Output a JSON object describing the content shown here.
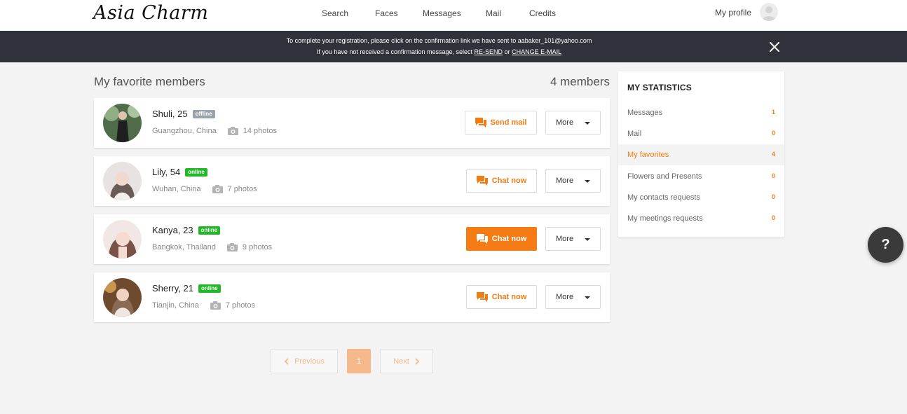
{
  "header": {
    "logo": "Asia Charm",
    "nav": [
      {
        "label": "Search"
      },
      {
        "label": "Faces"
      },
      {
        "label": "Messages"
      },
      {
        "label": "Mail"
      },
      {
        "label": "Credits"
      }
    ],
    "profile_label": "My profile"
  },
  "notice": {
    "line1": "To complete your registration, please click on the confirmation link we have sent to aabaker_101@yahoo.com",
    "line2_prefix": "If you have not received a confirmation message, select",
    "resend": "RE-SEND",
    "or": "or",
    "change_email": "CHANGE E-MAIL"
  },
  "main": {
    "title": "My favorite members",
    "count": "4 members",
    "members": [
      {
        "name": "Shuli, 25",
        "status": "offline",
        "location": "Guangzhou, China",
        "photos": "14 photos",
        "action": "Send mail",
        "more": "More"
      },
      {
        "name": "Lily, 54",
        "status": "online",
        "location": "Wuhan, China",
        "photos": "7 photos",
        "action": "Chat now",
        "more": "More"
      },
      {
        "name": "Kanya, 23",
        "status": "online",
        "location": "Bangkok, Thailand",
        "photos": "9 photos",
        "action": "Chat now",
        "more": "More"
      },
      {
        "name": "Sherry, 21",
        "status": "online",
        "location": "Tianjin, China",
        "photos": "7 photos",
        "action": "Chat now",
        "more": "More"
      }
    ]
  },
  "pagination": {
    "previous": "Previous",
    "current": "1",
    "next": "Next"
  },
  "stats": {
    "title": "MY STATISTICS",
    "rows": [
      {
        "label": "Messages",
        "count": "1"
      },
      {
        "label": "Mail",
        "count": "0"
      },
      {
        "label": "My favorites",
        "count": "4"
      },
      {
        "label": "Flowers and Presents",
        "count": "0"
      },
      {
        "label": "My contacts requests",
        "count": "0"
      },
      {
        "label": "My meetings requests",
        "count": "0"
      }
    ]
  },
  "help": "?",
  "colors": {
    "accent": "#f57c14",
    "online": "#21b928",
    "offline": "#9aa3ab",
    "notice_bg": "#2f323a"
  }
}
